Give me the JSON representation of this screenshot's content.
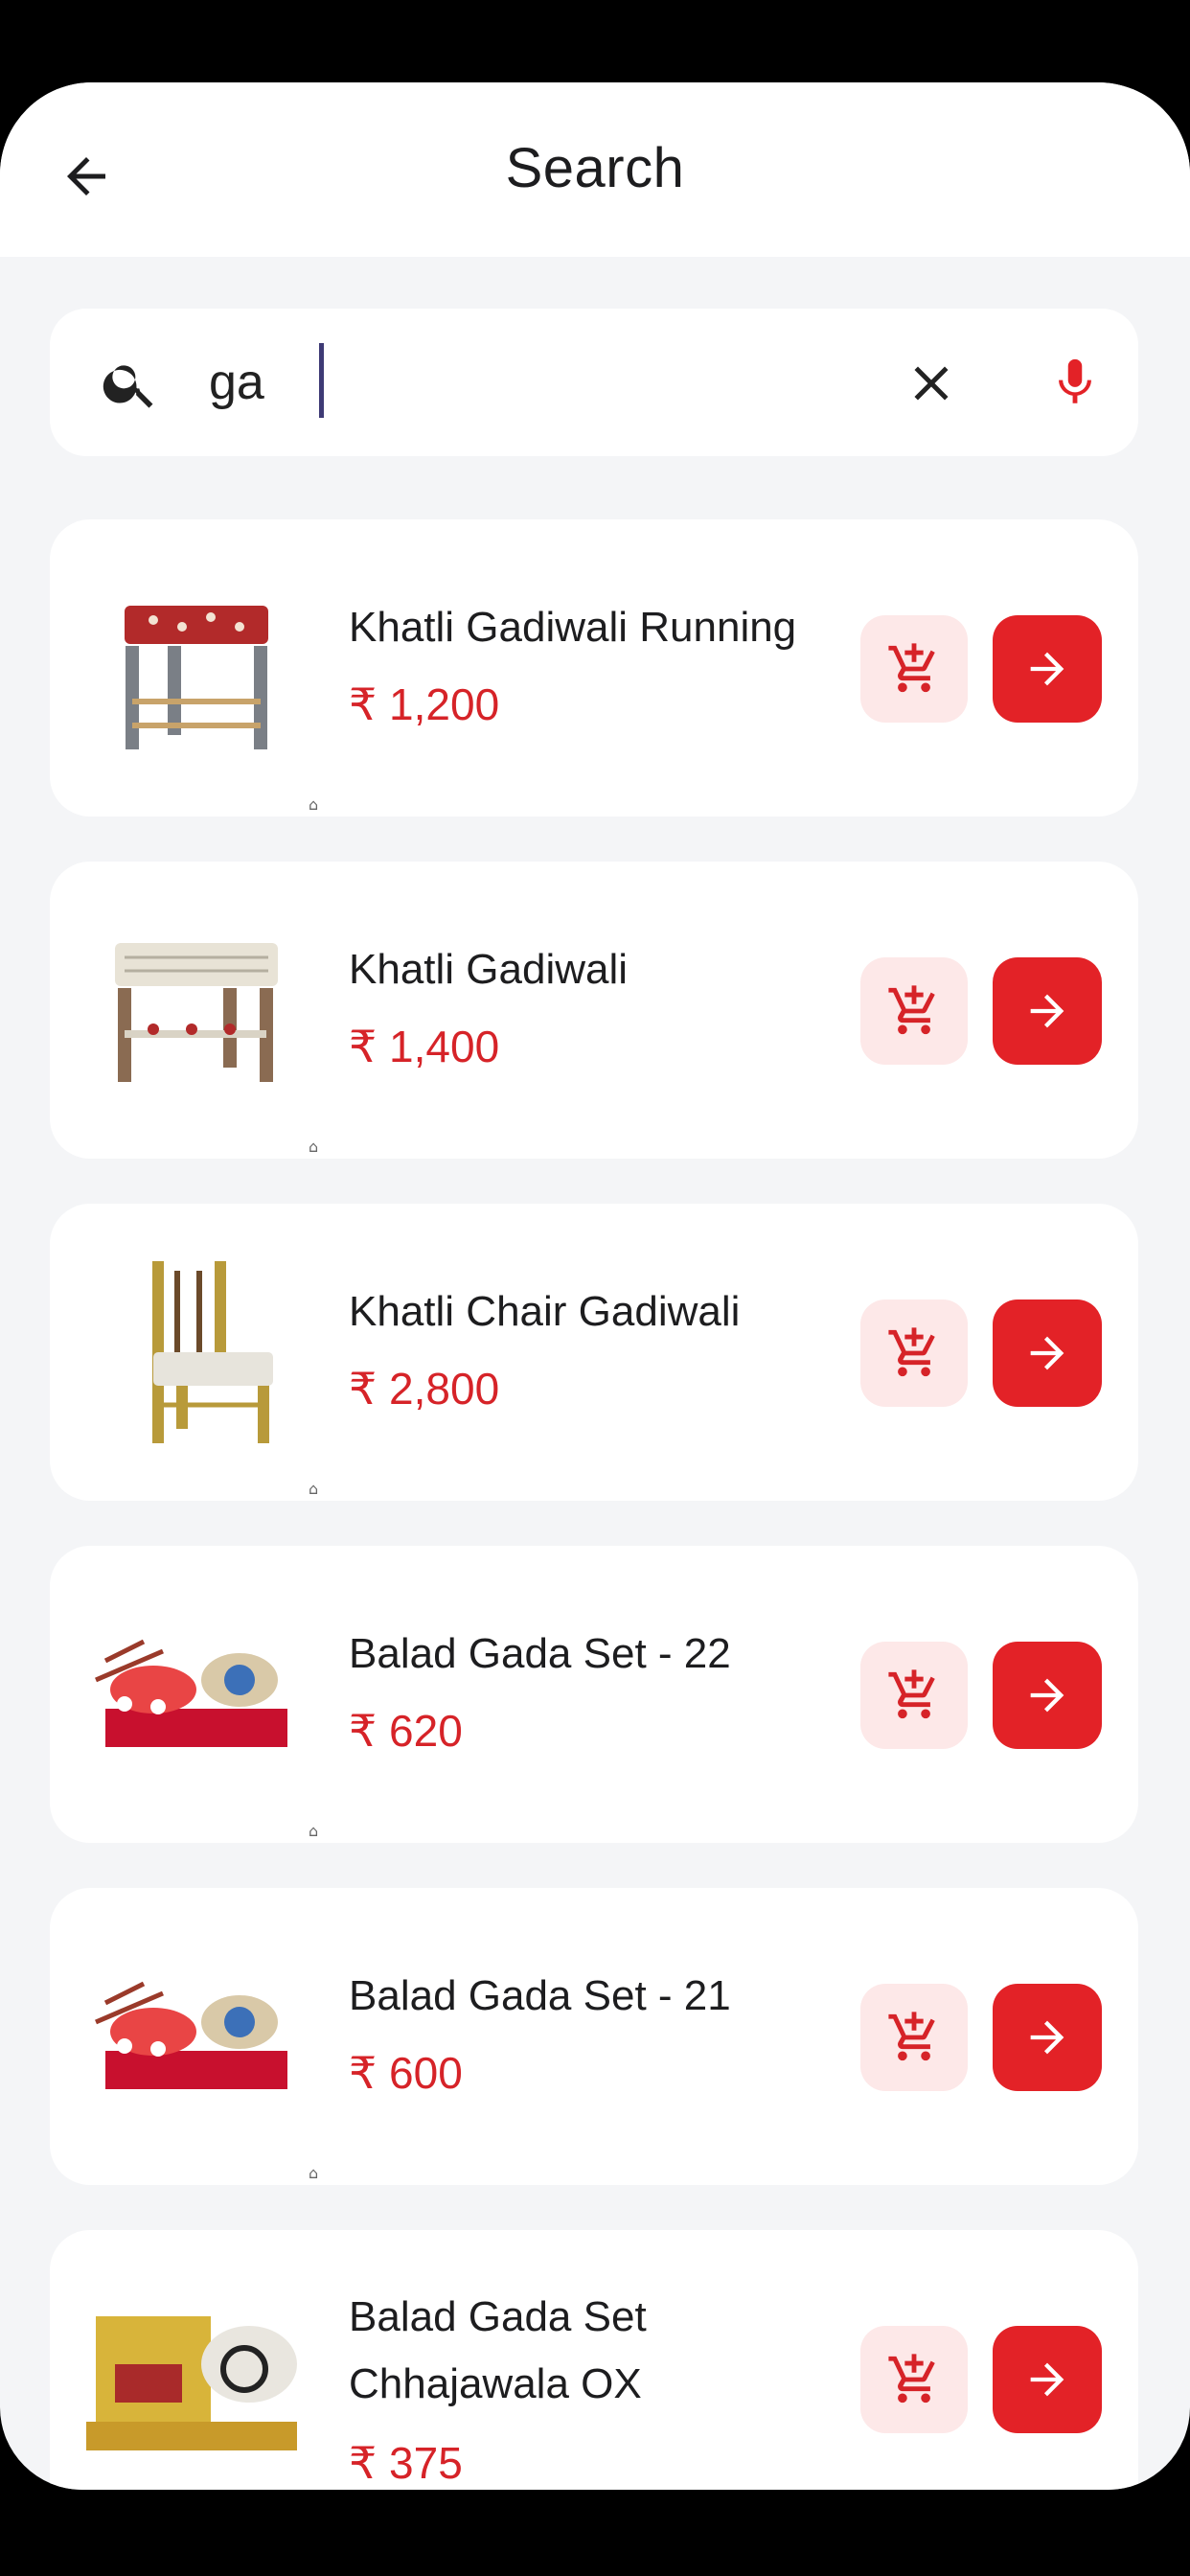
{
  "header": {
    "title": "Search",
    "back_icon": "arrow-left-icon"
  },
  "search": {
    "value": "ga",
    "search_icon": "search-icon",
    "clear_icon": "close-icon",
    "mic_icon": "microphone-icon"
  },
  "colors": {
    "accent": "#e32227",
    "price": "#d62328",
    "cart_bg": "#fde8e8",
    "page_bg": "#f4f5f7"
  },
  "products": [
    {
      "name": "Khatli Gadiwali Running",
      "price": "₹ 1,200",
      "image": "stool-red-fabric"
    },
    {
      "name": "Khatli Gadiwali",
      "price": "₹ 1,400",
      "image": "stool-white-fabric"
    },
    {
      "name": "Khatli Chair Gadiwali",
      "price": "₹ 2,800",
      "image": "chair-gold"
    },
    {
      "name": "Balad Gada Set - 22",
      "price": "₹ 620",
      "image": "bullock-cart-set"
    },
    {
      "name": "Balad Gada Set - 21",
      "price": "₹ 600",
      "image": "bullock-cart-set"
    },
    {
      "name": "Balad Gada Set Chhajawala OX",
      "price": "₹ 375",
      "image": "bullock-cart-gold"
    }
  ]
}
